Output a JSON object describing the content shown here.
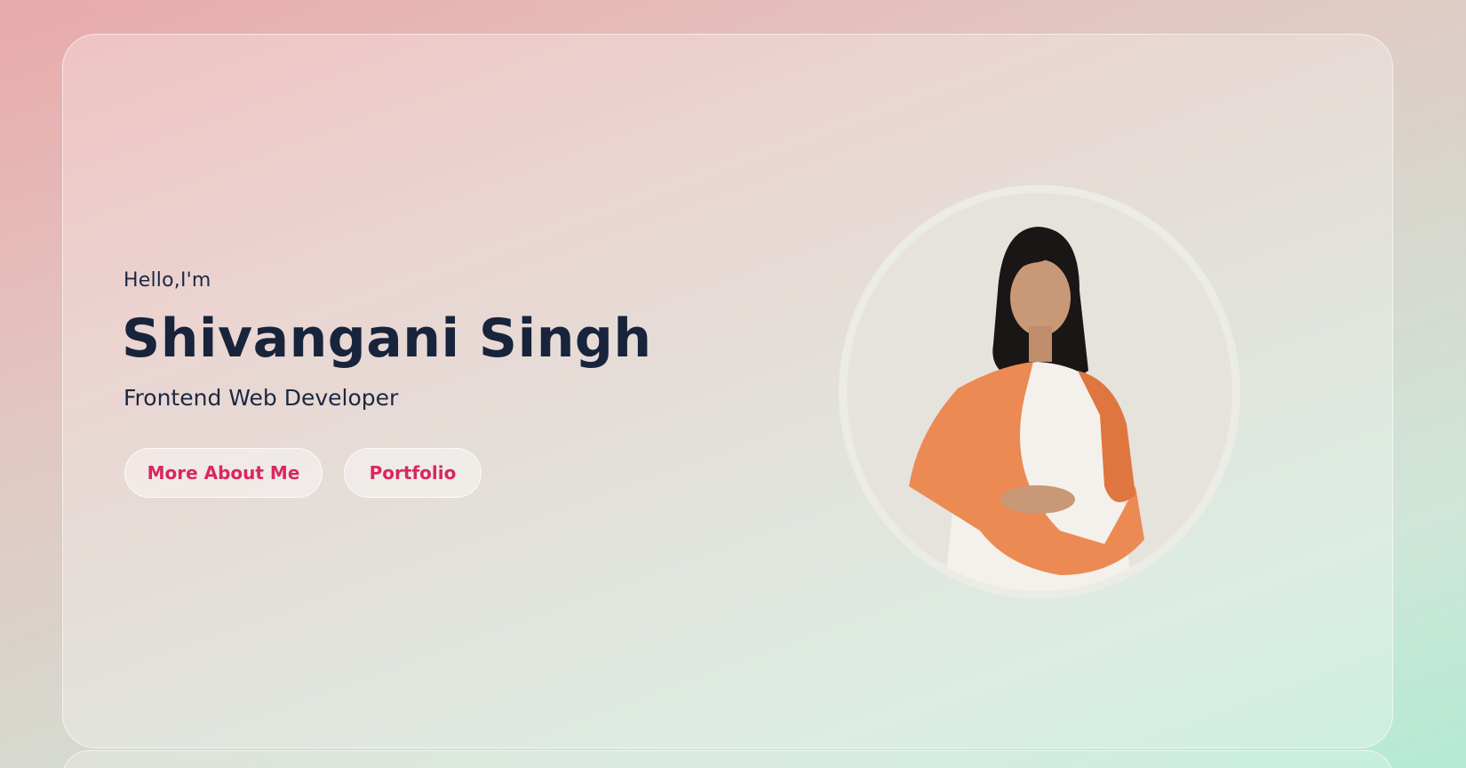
{
  "hero": {
    "greeting": "Hello,I'm",
    "name": "Shivangani Singh",
    "role": "Frontend Web Developer"
  },
  "buttons": {
    "about_label": "More About Me",
    "portfolio_label": "Portfolio"
  },
  "colors": {
    "accent": "#d8285f",
    "heading": "#18243b"
  },
  "images": {
    "profile_photo": "profile-photo"
  }
}
